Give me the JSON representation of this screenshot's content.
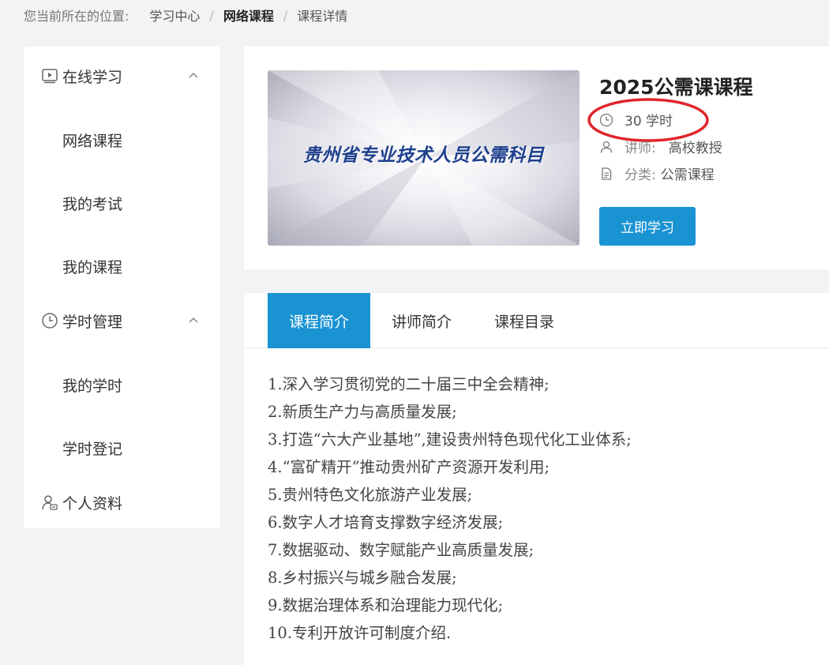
{
  "breadcrumb": {
    "prefix": "您当前所在的位置:",
    "items": [
      "学习中心",
      "网络课程",
      "课程详情"
    ]
  },
  "sidebar": {
    "groups": [
      {
        "label": "在线学习",
        "icon": "video-play-icon",
        "items": [
          "网络课程",
          "我的考试",
          "我的课程"
        ]
      },
      {
        "label": "学时管理",
        "icon": "clock-icon",
        "items": [
          "我的学时",
          "学时登记"
        ]
      },
      {
        "label": "个人资料",
        "icon": "user-card-icon",
        "items": []
      }
    ]
  },
  "course": {
    "cover_text": "贵州省专业技术人员公需科目",
    "title": "2025公需课课程",
    "hours": "30 学时",
    "teacher_key": "讲师:",
    "teacher_val": "高校教授",
    "category_key": "分类:",
    "category_val": "公需课程",
    "start_button": "立即学习"
  },
  "tabs": [
    {
      "label": "课程简介",
      "active": true
    },
    {
      "label": "讲师简介",
      "active": false
    },
    {
      "label": "课程目录",
      "active": false
    }
  ],
  "outline": [
    "1.深入学习贯彻党的二十届三中全会精神;",
    "2.新质生产力与高质量发展;",
    "3.打造“六大产业基地”,建设贵州特色现代化工业体系;",
    "4.“富矿精开”推动贵州矿产资源开发利用;",
    "5.贵州特色文化旅游产业发展;",
    "6.数字人才培育支撑数字经济发展;",
    "7.数据驱动、数字赋能产业高质量发展;",
    "8.乡村振兴与城乡融合发展;",
    "9.数据治理体系和治理能力现代化;",
    "10.专利开放许可制度介绍."
  ],
  "colors": {
    "accent": "#1a93d3",
    "highlight": "#e0242b",
    "page_bg": "#f2f3f5",
    "cover_text": "#1d3f8c"
  }
}
